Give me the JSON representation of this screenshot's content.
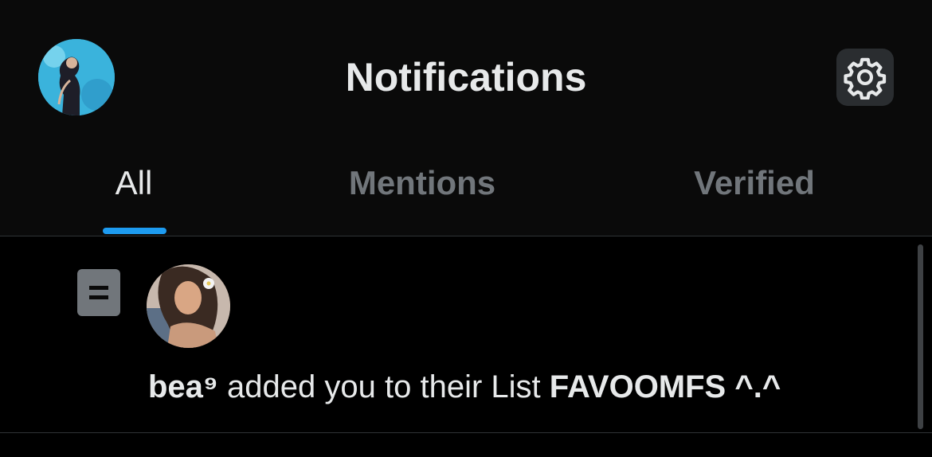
{
  "header": {
    "title": "Notifications",
    "avatar_icon": "user-avatar",
    "settings_icon": "gear-icon"
  },
  "tabs": [
    {
      "label": "All",
      "active": true
    },
    {
      "label": "Mentions",
      "active": false
    },
    {
      "label": "Verified",
      "active": false
    }
  ],
  "notifications": [
    {
      "type_icon": "list-icon",
      "actor": "bea⁹",
      "action": " added you to their List ",
      "list_name": "FAVOOMFS ^.^"
    }
  ],
  "colors": {
    "background": "#000000",
    "accent": "#1d9bf0",
    "text_primary": "#e7e9ea",
    "text_secondary": "#71767b"
  }
}
